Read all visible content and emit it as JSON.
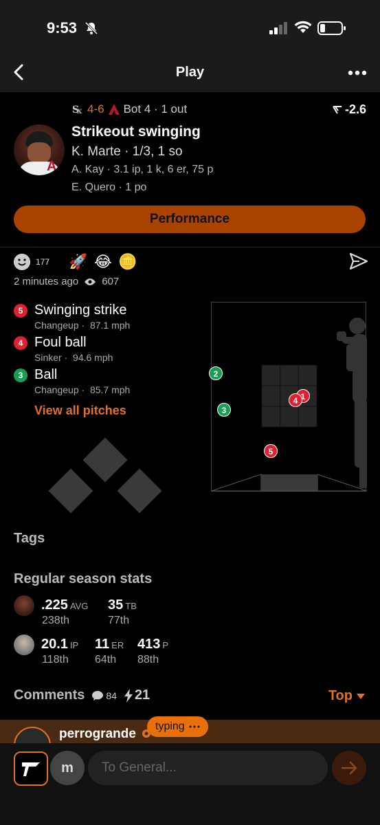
{
  "status_bar": {
    "time": "9:53"
  },
  "nav": {
    "title": "Play"
  },
  "play": {
    "score": "4-6",
    "inning": "Bot 4 · 1 out",
    "wpa": "-2.6",
    "title": "Strikeout swinging",
    "batter": "K. Marte · 1/3, 1 so",
    "pitcher": "A. Kay · 3.1 ip, 1 k, 6 er, 75 p",
    "fielder": "E. Quero · 1 po",
    "performance_label": "Performance"
  },
  "reactions": {
    "count": "177",
    "emojis": [
      "🚀",
      "😂",
      "🪙"
    ]
  },
  "meta": {
    "time_ago": "2 minutes ago",
    "views": "607"
  },
  "pitches": [
    {
      "number": "5",
      "result": "Swinging strike",
      "type": "Changeup",
      "speed": "87.1 mph",
      "color": "#e02030"
    },
    {
      "number": "4",
      "result": "Foul ball",
      "type": "Sinker",
      "speed": "94.6 mph",
      "color": "#e02030"
    },
    {
      "number": "3",
      "result": "Ball",
      "type": "Changeup",
      "speed": "85.7 mph",
      "color": "#1a9e55"
    }
  ],
  "view_all_label": "View all pitches",
  "zone_pitches": [
    {
      "number": "2",
      "color": "#1a9e55"
    },
    {
      "number": "3",
      "color": "#1a9e55"
    },
    {
      "number": "1",
      "color": "#e02030"
    },
    {
      "number": "4",
      "color": "#e02030"
    },
    {
      "number": "5",
      "color": "#e02030"
    }
  ],
  "tags": {
    "title": "Tags"
  },
  "season": {
    "title": "Regular season stats",
    "batter": {
      "stat1": {
        "value": ".225",
        "unit": "AVG",
        "rank": "238th"
      },
      "stat2": {
        "value": "35",
        "unit": "TB",
        "rank": "77th"
      }
    },
    "pitcher": {
      "stat1": {
        "value": "20.1",
        "unit": "IP",
        "rank": "118th"
      },
      "stat2": {
        "value": "11",
        "unit": "ER",
        "rank": "64th"
      },
      "stat3": {
        "value": "413",
        "unit": "P",
        "rank": "88th"
      }
    }
  },
  "comments": {
    "title": "Comments",
    "count": "84",
    "bolts": "21",
    "sort": "Top"
  },
  "latest_comment": {
    "user": "perrogrande",
    "typing": "typing"
  },
  "composer": {
    "avatar_letter": "m",
    "placeholder": "To General..."
  },
  "colors": {
    "accent": "#e0702a",
    "perf_button": "#a84300",
    "strike": "#e02030",
    "ball": "#1a9e55"
  }
}
